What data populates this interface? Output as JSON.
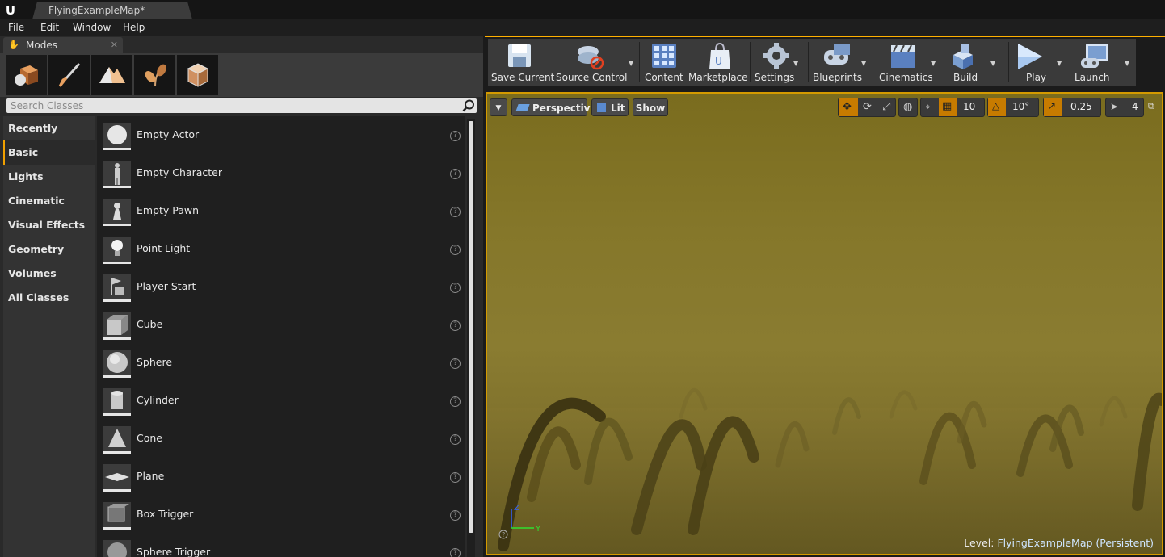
{
  "title_bar": {
    "doc_tab": "FlyingExampleMap*"
  },
  "menu": [
    "File",
    "Edit",
    "Window",
    "Help"
  ],
  "modes_panel": {
    "tab_label": "Modes",
    "search_placeholder": "Search Classes",
    "categories": [
      "Recently Placed",
      "Basic",
      "Lights",
      "Cinematic",
      "Visual Effects",
      "Geometry",
      "Volumes",
      "All Classes"
    ],
    "active_category": "Basic",
    "items": [
      "Empty Actor",
      "Empty Character",
      "Empty Pawn",
      "Point Light",
      "Player Start",
      "Cube",
      "Sphere",
      "Cylinder",
      "Cone",
      "Plane",
      "Box Trigger",
      "Sphere Trigger"
    ]
  },
  "toolbar": {
    "buttons": [
      "Save Current",
      "Source Control",
      "Content",
      "Marketplace",
      "Settings",
      "Blueprints",
      "Cinematics",
      "Build",
      "Play",
      "Launch"
    ]
  },
  "viewport": {
    "view_mode": "Perspective",
    "lighting": "Lit",
    "show": "Show",
    "grid_snap": "10",
    "rotation_snap": "10°",
    "scale_snap": "0.25",
    "camera_speed": "4",
    "level_prefix": "Level:",
    "level_name": "FlyingExampleMap (Persistent)",
    "axis_z": "Z",
    "axis_y": "Y",
    "accent_color": "#d49a00"
  }
}
